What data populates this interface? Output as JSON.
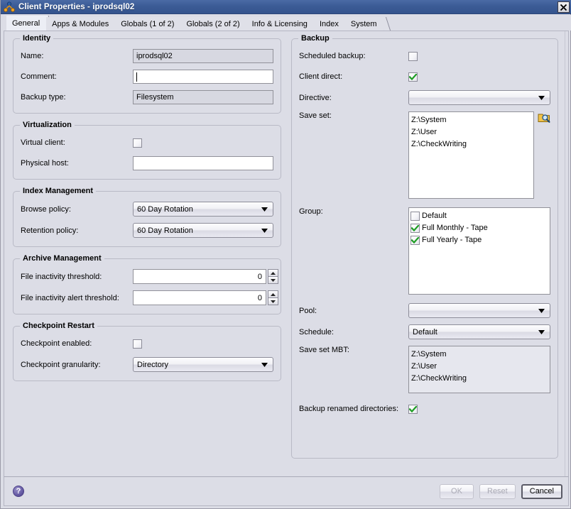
{
  "window": {
    "title": "Client Properties - iprodsql02",
    "icon": "client-node-icon",
    "close_label": "×"
  },
  "tabs": [
    {
      "label": "General",
      "selected": true
    },
    {
      "label": "Apps & Modules",
      "selected": false
    },
    {
      "label": "Globals (1 of 2)",
      "selected": false
    },
    {
      "label": "Globals (2 of 2)",
      "selected": false
    },
    {
      "label": "Info & Licensing",
      "selected": false
    },
    {
      "label": "Index",
      "selected": false
    },
    {
      "label": "System",
      "selected": false
    }
  ],
  "left": {
    "identity": {
      "title": "Identity",
      "name_label": "Name:",
      "name_value": "iprodsql02",
      "comment_label": "Comment:",
      "comment_value": "",
      "backup_type_label": "Backup type:",
      "backup_type_value": "Filesystem"
    },
    "virtualization": {
      "title": "Virtualization",
      "virtual_client_label": "Virtual client:",
      "virtual_client_checked": false,
      "physical_host_label": "Physical host:",
      "physical_host_value": ""
    },
    "index_management": {
      "title": "Index Management",
      "browse_policy_label": "Browse policy:",
      "browse_policy_value": "60 Day Rotation",
      "retention_policy_label": "Retention policy:",
      "retention_policy_value": "60 Day Rotation"
    },
    "archive_management": {
      "title": "Archive Management",
      "inactivity_threshold_label": "File inactivity threshold:",
      "inactivity_threshold_value": "0",
      "inactivity_alert_label": "File inactivity alert threshold:",
      "inactivity_alert_value": "0"
    },
    "checkpoint_restart": {
      "title": "Checkpoint Restart",
      "enabled_label": "Checkpoint enabled:",
      "enabled_checked": false,
      "granularity_label": "Checkpoint granularity:",
      "granularity_value": "Directory"
    }
  },
  "right": {
    "backup": {
      "title": "Backup",
      "scheduled_backup_label": "Scheduled backup:",
      "scheduled_backup_checked": false,
      "client_direct_label": "Client direct:",
      "client_direct_checked": true,
      "directive_label": "Directive:",
      "directive_value": "",
      "save_set_label": "Save set:",
      "save_set_items": [
        "Z:\\System",
        "Z:\\User",
        "Z:\\CheckWriting"
      ],
      "save_set_browse_icon": "folder-search-icon",
      "group_label": "Group:",
      "group_items": [
        {
          "label": "Default",
          "checked": false
        },
        {
          "label": "Full Monthly - Tape",
          "checked": true
        },
        {
          "label": "Full Yearly - Tape",
          "checked": true
        }
      ],
      "pool_label": "Pool:",
      "pool_value": "",
      "schedule_label": "Schedule:",
      "schedule_value": "Default",
      "save_set_mbt_label": "Save set MBT:",
      "save_set_mbt_items": [
        "Z:\\System",
        "Z:\\User",
        "Z:\\CheckWriting"
      ],
      "backup_renamed_label": "Backup renamed directories:",
      "backup_renamed_checked": true
    }
  },
  "footer": {
    "help_label": "?",
    "ok_label": "OK",
    "reset_label": "Reset",
    "cancel_label": "Cancel"
  },
  "colors": {
    "titlebar": "#3c5c96",
    "window_bg": "#dcdde6",
    "check_green": "#1f9e25",
    "field_border": "#919199",
    "group_border": "#b9bac6"
  }
}
